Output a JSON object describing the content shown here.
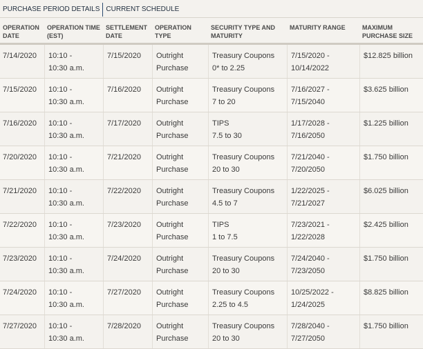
{
  "tabs": [
    "PURCHASE PERIOD DETAILS",
    "CURRENT SCHEDULE"
  ],
  "columns": [
    [
      "OPERATION",
      "DATE"
    ],
    [
      "OPERATION TIME",
      "(EST)"
    ],
    [
      "SETTLEMENT",
      "DATE"
    ],
    [
      "OPERATION",
      "TYPE"
    ],
    [
      "SECURITY TYPE AND",
      "MATURITY"
    ],
    [
      "MATURITY RANGE",
      ""
    ],
    [
      "MAXIMUM",
      "PURCHASE SIZE"
    ]
  ],
  "rows": [
    {
      "op_date": "7/14/2020",
      "time": [
        "10:10 -",
        "10:30 a.m."
      ],
      "settle": "7/15/2020",
      "type": [
        "Outright",
        "Purchase"
      ],
      "security": [
        "Treasury Coupons",
        "0* to 2.25"
      ],
      "range": [
        "7/15/2020 -",
        "10/14/2022"
      ],
      "size": "$12.825 billion"
    },
    {
      "op_date": "7/15/2020",
      "time": [
        "10:10 -",
        "10:30 a.m."
      ],
      "settle": "7/16/2020",
      "type": [
        "Outright",
        "Purchase"
      ],
      "security": [
        "Treasury Coupons",
        "7 to 20"
      ],
      "range": [
        "7/16/2027 -",
        "7/15/2040"
      ],
      "size": "$3.625 billion"
    },
    {
      "op_date": "7/16/2020",
      "time": [
        "10:10 -",
        "10:30 a.m."
      ],
      "settle": "7/17/2020",
      "type": [
        "Outright",
        "Purchase"
      ],
      "security": [
        "TIPS",
        "7.5 to 30"
      ],
      "range": [
        "1/17/2028 -",
        "7/16/2050"
      ],
      "size": "$1.225 billion"
    },
    {
      "op_date": "7/20/2020",
      "time": [
        "10:10 -",
        "10:30 a.m."
      ],
      "settle": "7/21/2020",
      "type": [
        "Outright",
        "Purchase"
      ],
      "security": [
        "Treasury Coupons",
        "20 to 30"
      ],
      "range": [
        "7/21/2040 -",
        "7/20/2050"
      ],
      "size": "$1.750 billion"
    },
    {
      "op_date": "7/21/2020",
      "time": [
        "10:10 -",
        "10:30 a.m."
      ],
      "settle": "7/22/2020",
      "type": [
        "Outright",
        "Purchase"
      ],
      "security": [
        "Treasury Coupons",
        "4.5 to 7"
      ],
      "range": [
        "1/22/2025 -",
        "7/21/2027"
      ],
      "size": "$6.025 billion"
    },
    {
      "op_date": "7/22/2020",
      "time": [
        "10:10 -",
        "10:30 a.m."
      ],
      "settle": "7/23/2020",
      "type": [
        "Outright",
        "Purchase"
      ],
      "security": [
        "TIPS",
        "1 to 7.5"
      ],
      "range": [
        "7/23/2021 -",
        "1/22/2028"
      ],
      "size": "$2.425 billion"
    },
    {
      "op_date": "7/23/2020",
      "time": [
        "10:10 -",
        "10:30 a.m."
      ],
      "settle": "7/24/2020",
      "type": [
        "Outright",
        "Purchase"
      ],
      "security": [
        "Treasury Coupons",
        "20 to 30"
      ],
      "range": [
        "7/24/2040 -",
        "7/23/2050"
      ],
      "size": "$1.750 billion"
    },
    {
      "op_date": "7/24/2020",
      "time": [
        "10:10 -",
        "10:30 a.m."
      ],
      "settle": "7/27/2020",
      "type": [
        "Outright",
        "Purchase"
      ],
      "security": [
        "Treasury Coupons",
        "2.25 to 4.5"
      ],
      "range": [
        "10/25/2022 -",
        "1/24/2025"
      ],
      "size": "$8.825 billion"
    },
    {
      "op_date": "7/27/2020",
      "time": [
        "10:10 -",
        "10:30 a.m."
      ],
      "settle": "7/28/2020",
      "type": [
        "Outright",
        "Purchase"
      ],
      "security": [
        "Treasury Coupons",
        "20 to 30"
      ],
      "range": [
        "7/28/2040 -",
        "7/27/2050"
      ],
      "size": "$1.750 billion"
    }
  ]
}
